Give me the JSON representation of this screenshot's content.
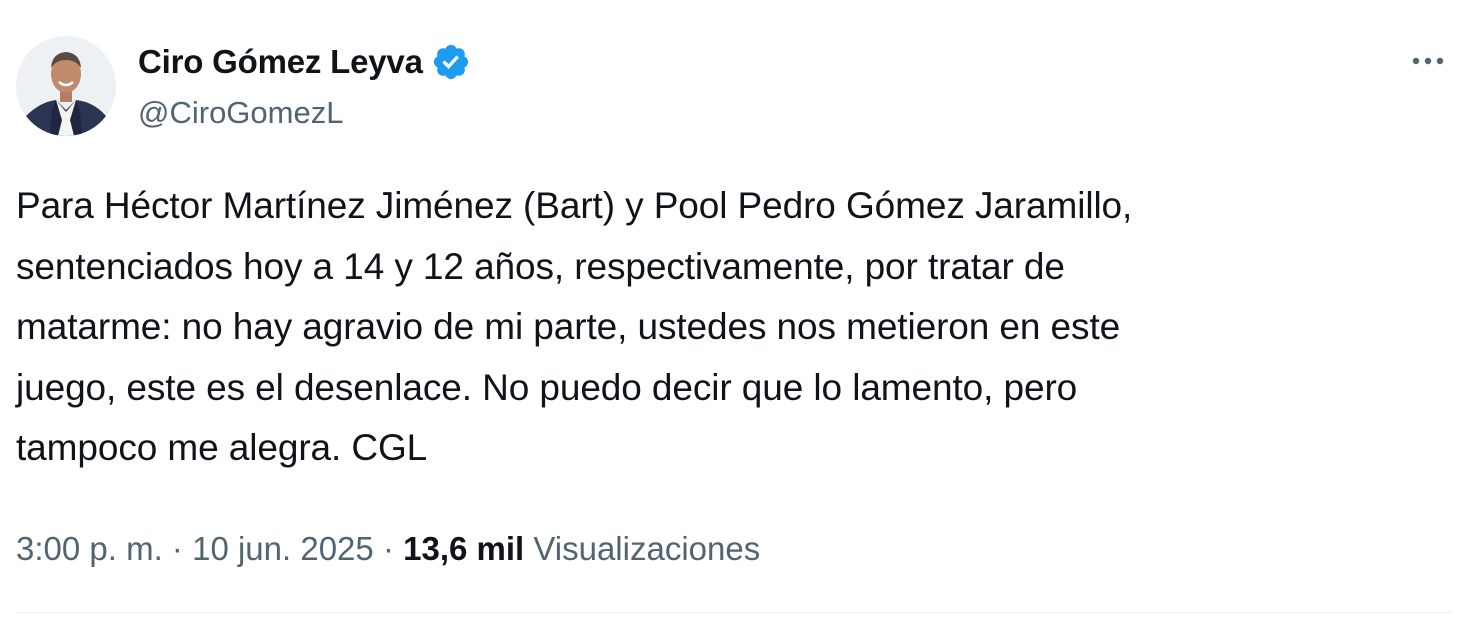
{
  "author": {
    "display_name": "Ciro Gómez Leyva",
    "handle": "@CiroGomezL",
    "verified": true
  },
  "tweet": {
    "text": "Para Héctor Martínez Jiménez (Bart) y Pool Pedro Gómez Jaramillo,\nsentenciados hoy a 14 y 12 años, respectivamente, por tratar de\nmatarme: no hay agravio de mi parte, ustedes nos metieron en este\njuego, este es el desenlace. No puedo decir que lo lamento, pero\ntampoco me alegra. CGL",
    "time": "3:00 p. m.",
    "separator": "·",
    "date": "10 jun. 2025",
    "views_count": "13,6 mil",
    "views_label": "Visualizaciones"
  },
  "icons": {
    "more": "more-horizontal-icon",
    "verified": "verified-badge-icon"
  },
  "colors": {
    "text_primary": "#0f1419",
    "text_secondary": "#536471",
    "verified_blue": "#1d9bf0",
    "divider": "#eff3f4"
  }
}
